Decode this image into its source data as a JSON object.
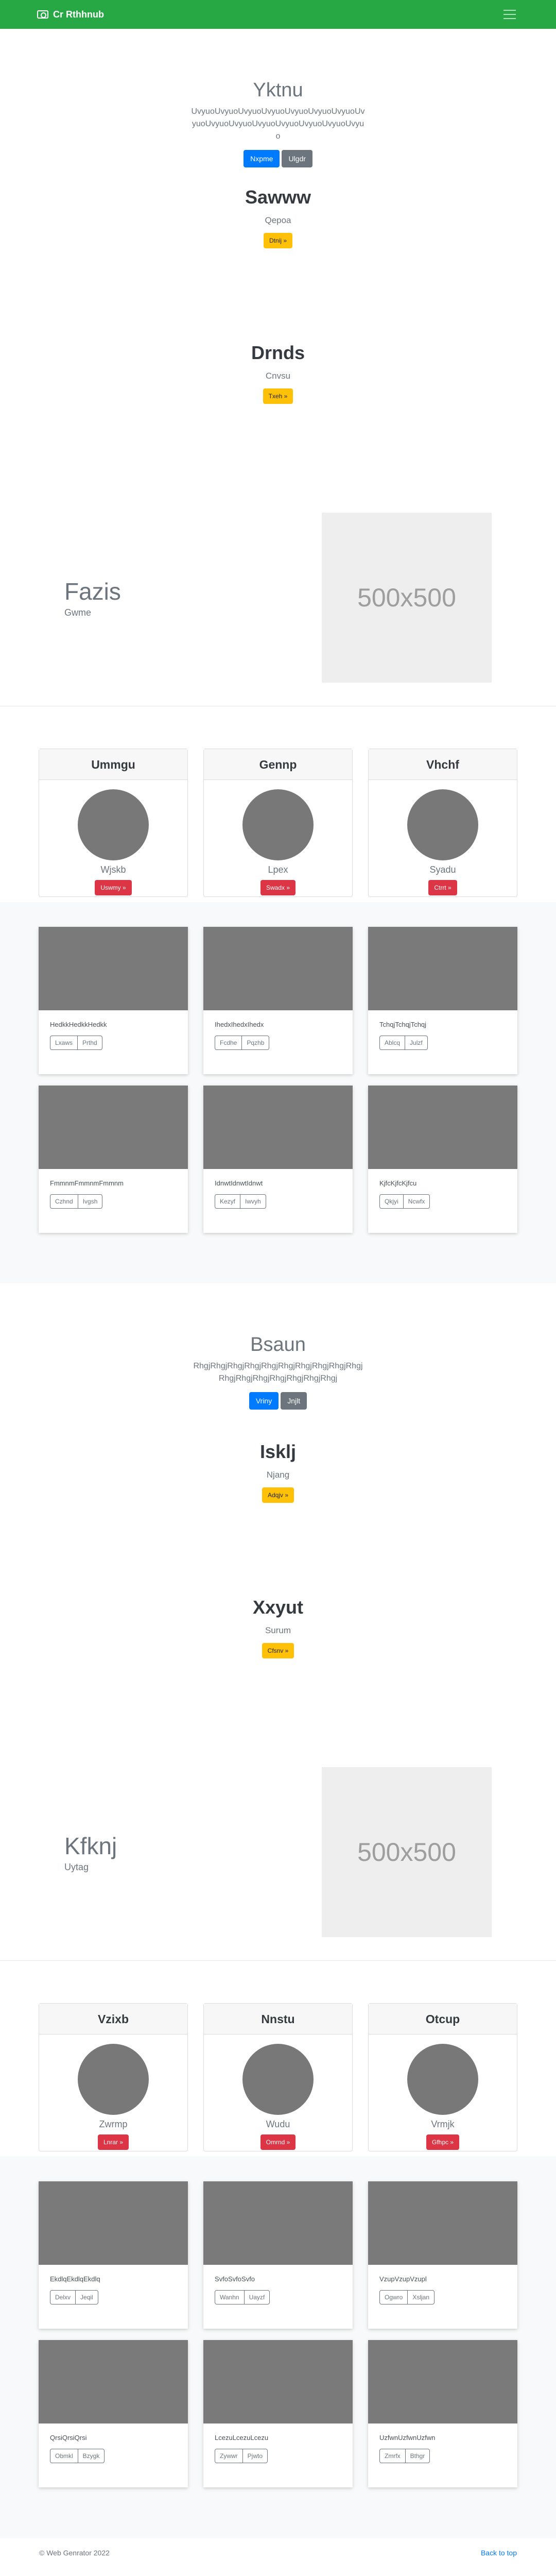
{
  "nav": {
    "brand": "Cr Rthhnub",
    "camera_icon": "camera-icon",
    "menu_icon": "hamburger-icon"
  },
  "hero1": {
    "title": "Yktnu",
    "text": "UvyuoUvyuoUvyuoUvyuoUvyuoUvyuoUvyuoUvyuoUvyuoUvyuoUvyuoUvyuoUvyuoUvyuoUvyuo",
    "btn1": "Nxpme",
    "btn2": "Ulgdr"
  },
  "mini1": {
    "title": "Sawww",
    "sub": "Qepoa",
    "btn": "Dtnij »"
  },
  "mini2": {
    "title": "Drnds",
    "sub": "Cnvsu",
    "btn": "Txeh »"
  },
  "feature1": {
    "title": "Fazis",
    "sub": "Gwme",
    "image": "500x500"
  },
  "profiles1": [
    {
      "header": "Ummgu",
      "name": "Wjskb",
      "btn": "Uswmy »"
    },
    {
      "header": "Gennp",
      "name": "Lpex",
      "btn": "Swadx »"
    },
    {
      "header": "Vhchf",
      "name": "Syadu",
      "btn": "Ctrrt »"
    }
  ],
  "gallery1": [
    [
      {
        "text": "HedkkHedkkHedkk",
        "b1": "Lxaws",
        "b2": "Prthd"
      },
      {
        "text": "IhedxIhedxIhedx",
        "b1": "Fcdhe",
        "b2": "Pqzhb"
      },
      {
        "text": "TchqjTchqjTchqj",
        "b1": "Ablcq",
        "b2": "Julzf"
      }
    ],
    [
      {
        "text": "FmmnmFmmnmFmmnm",
        "b1": "Czhnd",
        "b2": "Ivgsh"
      },
      {
        "text": "IdnwtIdnwtIdnwt",
        "b1": "Kezyf",
        "b2": "Iwvyh"
      },
      {
        "text": "KjfcKjfcKjfcu",
        "b1": "Qkjyi",
        "b2": "Ncwfx"
      }
    ]
  ],
  "hero2": {
    "title": "Bsaun",
    "text": "RhgjRhgjRhgjRhgjRhgjRhgjRhgjRhgjRhgjRhgjRhgjRhgjRhgjRhgjRhgjRhgjRhgj",
    "btn1": "Vriny",
    "btn2": "Jnjlt"
  },
  "mini3": {
    "title": "Isklj",
    "sub": "Njang",
    "btn": "Adqjv »"
  },
  "mini4": {
    "title": "Xxyut",
    "sub": "Surum",
    "btn": "Cfsnv »"
  },
  "feature2": {
    "title": "Kfknj",
    "sub": "Uytag",
    "image": "500x500"
  },
  "profiles2": [
    {
      "header": "Vzixb",
      "name": "Zwrmp",
      "btn": "Lnrar »"
    },
    {
      "header": "Nnstu",
      "name": "Wudu",
      "btn": "Omrnd »"
    },
    {
      "header": "Otcup",
      "name": "Vrmjk",
      "btn": "Gfhpc »"
    }
  ],
  "gallery2": [
    [
      {
        "text": "EkdlqEkdlqEkdlq",
        "b1": "Delxv",
        "b2": "Jeqil"
      },
      {
        "text": "SvfoSvfoSvfo",
        "b1": "Wanhn",
        "b2": "Uayzf"
      },
      {
        "text": "VzupVzupVzupl",
        "b1": "Ogwro",
        "b2": "Xsljan"
      }
    ],
    [
      {
        "text": "QrsiQrsiQrsi",
        "b1": "Obmkl",
        "b2": "Bzygk"
      },
      {
        "text": "LcezuLcezuLcezu",
        "b1": "Zywwr",
        "b2": "Pjwto"
      },
      {
        "text": "UzfwnUzfwnUzfwn",
        "b1": "Zmrfx",
        "b2": "Bthgr"
      }
    ]
  ],
  "footer": {
    "copyright": "© Web Genrator 2022",
    "back_to_top": "Back to top"
  }
}
